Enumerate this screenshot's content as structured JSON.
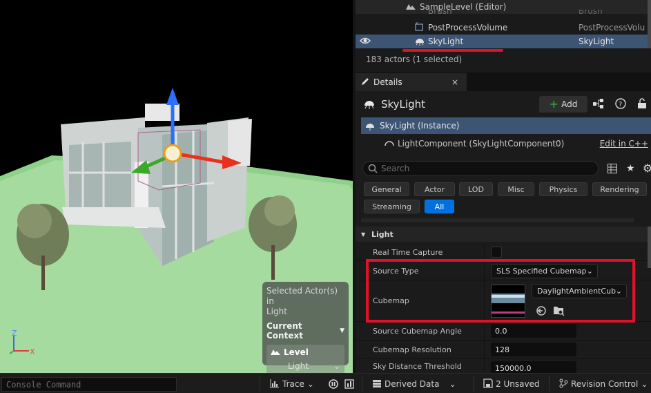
{
  "outliner": {
    "rows": [
      {
        "name": "SampleLevel (Editor)",
        "type": ""
      },
      {
        "name": "Brush",
        "type": "Brush"
      },
      {
        "name": "PostProcessVolume",
        "type": "PostProcessVolu"
      },
      {
        "name": "SkyLight",
        "type": "SkyLight"
      }
    ],
    "actor_count": "183 actors (1 selected)"
  },
  "details": {
    "tab_label": "Details",
    "close_glyph": "×",
    "title": "SkyLight",
    "add_label": "Add",
    "instance_label": "SkyLight (Instance)",
    "component_label": "LightComponent (SkyLightComponent0)",
    "edit_cpp_label": "Edit in C++",
    "search_placeholder": "Search",
    "categories": [
      "General",
      "Actor",
      "LOD",
      "Misc",
      "Physics",
      "Rendering",
      "Streaming",
      "All"
    ],
    "section": "Light",
    "props": {
      "real_time_capture": "Real Time Capture",
      "source_type_label": "Source Type",
      "source_type_value": "SLS Specified Cubemap",
      "cubemap_label": "Cubemap",
      "cubemap_value": "DaylightAmbientCub",
      "angle_label": "Source Cubemap Angle",
      "angle_value": "0.0",
      "resolution_label": "Cubemap Resolution",
      "resolution_value": "128",
      "distance_label": "Sky Distance Threshold",
      "distance_value": "150000.0"
    }
  },
  "viewport": {
    "selection_title": "Selected Actor(s) in",
    "selection_subtitle": "Light",
    "current_context": "Current Context",
    "level_label": "Level",
    "light_label": "Light",
    "axis_z": "Z",
    "axis_x": "X"
  },
  "statusbar": {
    "console_placeholder": "Console Command",
    "trace": "Trace",
    "derived_data": "Derived Data",
    "unsaved": "2 Unsaved",
    "revision_control": "Revision Control"
  },
  "colors": {
    "accent_blue": "#0070e0",
    "selection_blue": "#3c5575",
    "highlight_red": "#e0112b"
  }
}
